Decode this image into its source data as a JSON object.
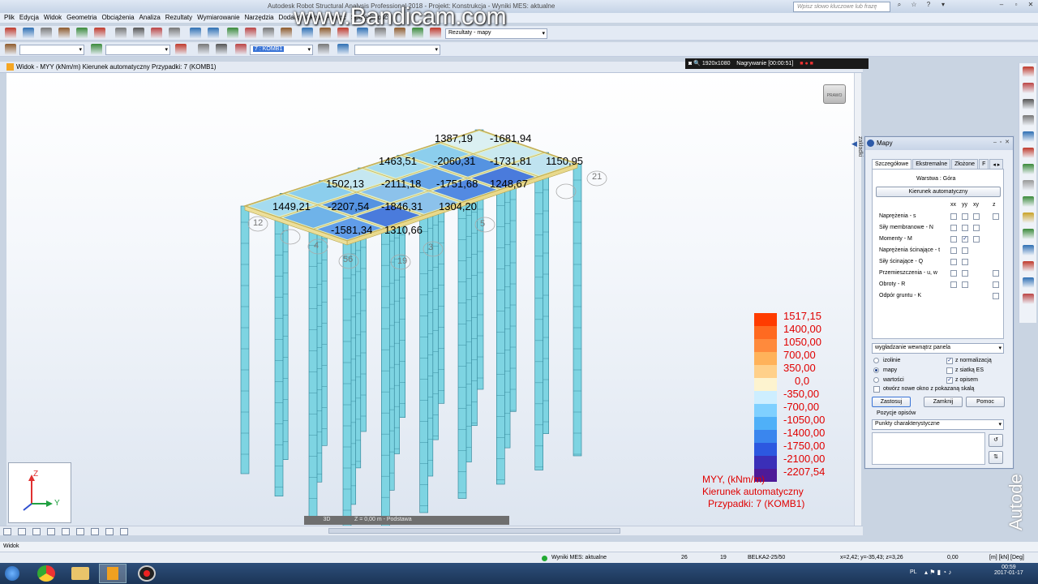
{
  "window": {
    "title": "Autodesk Robot Structural Analysis Professional 2018 - Projekt: Konstrukcja - Wyniki MES: aktualne",
    "watermark": "www.Bandicam.com",
    "search_placeholder": "Wpisz słowo kluczowe lub frazę",
    "win_controls": [
      "–",
      "▫",
      "✕"
    ]
  },
  "menu": [
    "Plik",
    "Edycja",
    "Widok",
    "Geometria",
    "Obciążenia",
    "Analiza",
    "Rezultaty",
    "Wymiarowanie",
    "Narzędzia",
    "Dodatki",
    "Okno",
    "Pomoc",
    "Społeczność"
  ],
  "toolbar": {
    "results_combo": "Rezultaty - mapy",
    "case_combo": "7 : KOMB1"
  },
  "recording": {
    "resolution": "1920x1080",
    "status": "Nagrywanie [00:00:51]"
  },
  "view": {
    "header": "Widok - MYY (kNm/m) Kierunek automatyczny Przypadki: 7 (KOMB1)",
    "viewcube": "PRAWO",
    "mode": "3D",
    "plane": "Z = 0,00 m - Podstawa",
    "side_tab": "zakładki"
  },
  "values": [
    "1387,19",
    "-1681,94",
    "1463,51",
    "-2060,31",
    "-1731,81",
    "1150,95",
    "1502,13",
    "-2111,18",
    "-1751,68",
    "1248,67",
    "1449,21",
    "-2207,54",
    "-1846,31",
    "1304,20",
    "-1581,34",
    "1310,66"
  ],
  "nodes": [
    "21",
    "12",
    "56",
    "19",
    "3",
    "4",
    "5"
  ],
  "legend": {
    "items": [
      {
        "label": "1517,15",
        "color": "#ff3c00"
      },
      {
        "label": "1400,00",
        "color": "#ff6a20"
      },
      {
        "label": "1050,00",
        "color": "#ff8a3c"
      },
      {
        "label": "700,00",
        "color": "#ffb25a"
      },
      {
        "label": "350,00",
        "color": "#ffd08a"
      },
      {
        "label": "0,0",
        "color": "#fdf3cf"
      },
      {
        "label": "-350,00",
        "color": "#cdeeff"
      },
      {
        "label": "-700,00",
        "color": "#7fd0ff"
      },
      {
        "label": "-1050,00",
        "color": "#4fb0f8"
      },
      {
        "label": "-1400,00",
        "color": "#3a86ee"
      },
      {
        "label": "-1750,00",
        "color": "#2c58e0"
      },
      {
        "label": "-2100,00",
        "color": "#3a2fb8"
      },
      {
        "label": "-2207,54",
        "color": "#4d1a98"
      }
    ],
    "caption": [
      "MYY, (kNm/m)",
      "Kierunek automatyczny",
      "Przypadki: 7 (KOMB1)"
    ]
  },
  "axes": {
    "z": "Z",
    "y": "Y"
  },
  "mapy": {
    "title": "Mapy",
    "tabs": [
      "Szczegółowe",
      "Ekstremalne",
      "Złożone",
      "F"
    ],
    "layer": "Warstwa : Góra",
    "auto_dir_button": "Kierunek automatyczny",
    "col_headers": [
      "xx",
      "yy",
      "xy",
      "z"
    ],
    "rows": [
      "Naprężenia - s",
      "Siły membranowe - N",
      "Momenty - M",
      "Naprężenia ścinające - t",
      "Siły ścinające - Q",
      "Przemieszczenia - u, w",
      "Obroty - R",
      "Odpór gruntu - K"
    ],
    "smoothing": "wygładzanie wewnątrz panela",
    "radio": [
      "izolinie",
      "mapy",
      "wartości"
    ],
    "checks": [
      "z normalizacją",
      "z siatką ES",
      "z opisem"
    ],
    "new_window": "otwórz nowe okno z pokazaną skalą",
    "buttons": [
      "Zastosuj",
      "Zamknij",
      "Pomoc"
    ],
    "pos_label": "Pozycje opisów",
    "pos_value": "Punkty charakterystyczne"
  },
  "brand": "Autode",
  "widok_strip": "Widok",
  "status": {
    "fem": "Wyniki MES: aktualne",
    "n1": "26",
    "n2": "19",
    "section": "BELKA2-25/50",
    "coords": "x=2,42; y=-35,43; z=3,26",
    "angle": "0,00",
    "units": "[m] [kN] [Deg]"
  },
  "taskbar": {
    "lang": "PL",
    "time": "00:59",
    "date": "2017-01-17"
  }
}
